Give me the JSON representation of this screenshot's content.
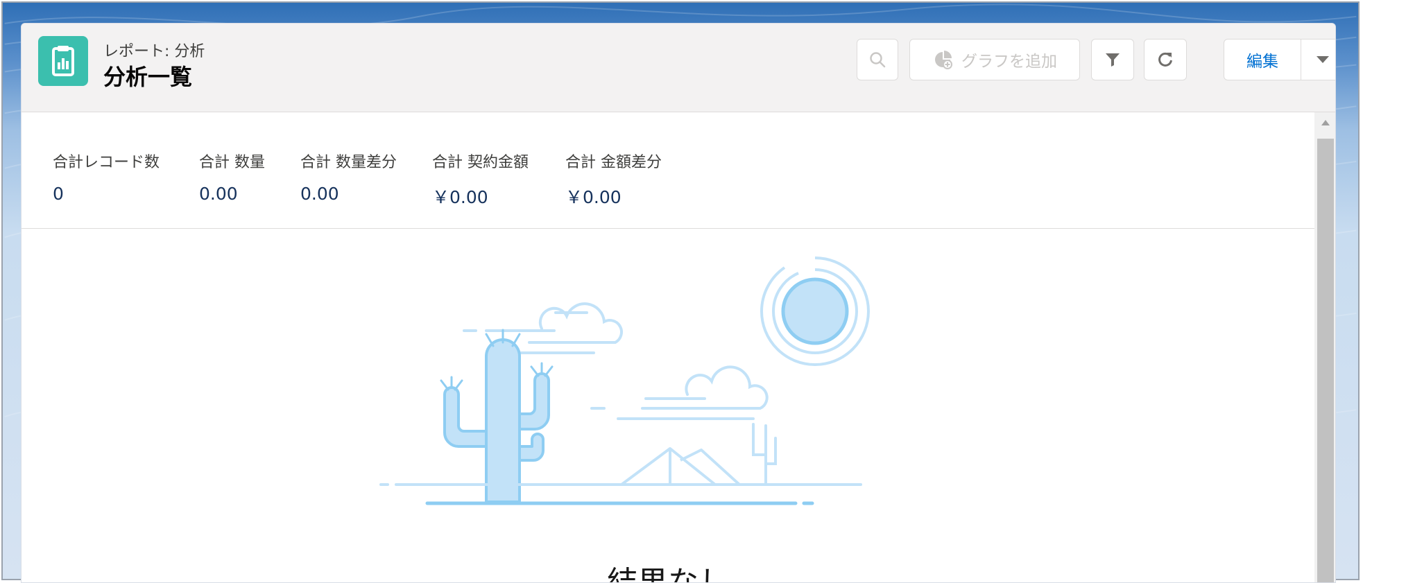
{
  "header": {
    "eyebrow": "レポート: 分析",
    "title": "分析一覧",
    "add_chart_label": "グラフを追加",
    "edit_label": "編集"
  },
  "icons": {
    "report": "report-icon",
    "search": "search-icon",
    "chart": "chart-icon",
    "filter": "filter-icon",
    "refresh": "refresh-icon",
    "dropdown": "chevron-down-icon"
  },
  "summary": {
    "metrics": [
      {
        "label": "合計レコード数",
        "value": "0"
      },
      {
        "label": "合計 数量",
        "value": "0.00"
      },
      {
        "label": "合計 数量差分",
        "value": "0.00"
      },
      {
        "label": "合計 契約金額",
        "value": "￥0.00"
      },
      {
        "label": "合計 金額差分",
        "value": "￥0.00"
      }
    ]
  },
  "empty_state": {
    "message": "結果なし"
  },
  "colors": {
    "brand_icon": "#3bbfae",
    "link_blue": "#0070d2",
    "value_text": "#16325c",
    "illustration_light": "#c2e2f8",
    "illustration_line": "#8ecdf2"
  }
}
